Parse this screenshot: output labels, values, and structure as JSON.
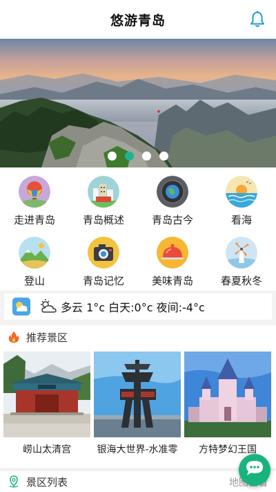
{
  "header": {
    "title": "悠游青岛",
    "bell_icon": "bell-icon",
    "accent": "#1e9fd8"
  },
  "banner": {
    "slide_count": 4,
    "active_index": 1,
    "active_color": "#1fb48f"
  },
  "categories": [
    {
      "label": "走进青岛",
      "icon": "hot-air-balloon-icon"
    },
    {
      "label": "青岛概述",
      "icon": "city-overview-icon"
    },
    {
      "label": "青岛古今",
      "icon": "globe-record-icon"
    },
    {
      "label": "看海",
      "icon": "sea-sunset-icon"
    },
    {
      "label": "登山",
      "icon": "mountain-icon"
    },
    {
      "label": "青岛记忆",
      "icon": "camera-icon"
    },
    {
      "label": "美味青岛",
      "icon": "food-cloche-icon"
    },
    {
      "label": "春夏秋冬",
      "icon": "windmill-icon"
    }
  ],
  "weather": {
    "text": "多云 1°c   白天:0°c  夜间:-4°c"
  },
  "recommended": {
    "title": "推荐景区",
    "items": [
      {
        "caption": "崂山太清宫"
      },
      {
        "caption": "银海大世界-水准零"
      },
      {
        "caption": "方特梦幻王国"
      }
    ]
  },
  "scenic_list": {
    "title": "景区列表",
    "map_link": "地图查看"
  },
  "chat_button": {
    "icon": "chat-bubble-icon",
    "color": "#19b47e"
  }
}
